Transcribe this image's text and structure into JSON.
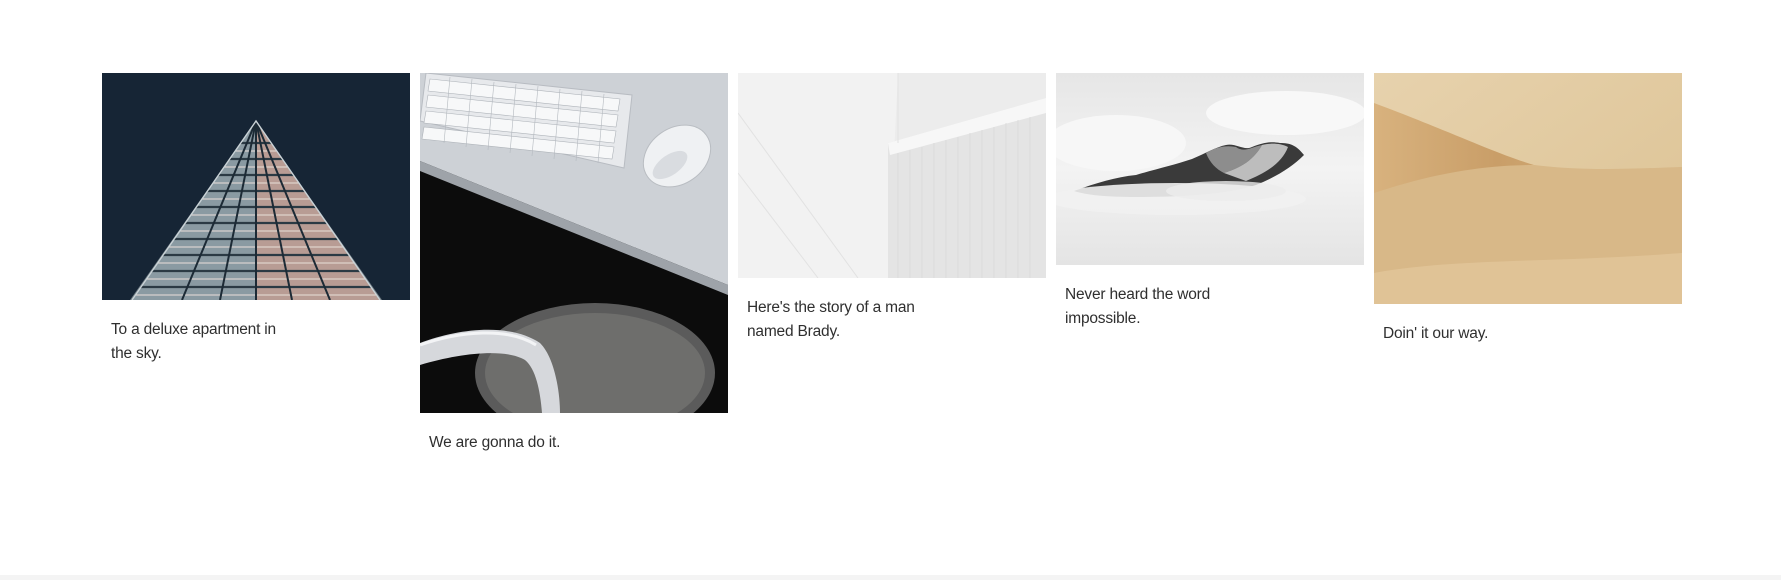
{
  "gallery": {
    "items": [
      {
        "caption": "To a deluxe apartment in the sky.",
        "image": "triangular-building-photo"
      },
      {
        "caption": "We are gonna do it.",
        "image": "desk-keyboard-mouse-photo"
      },
      {
        "caption": "Here's the story of a man named Brady.",
        "image": "white-architecture-photo"
      },
      {
        "caption": "Never heard the word impossible.",
        "image": "misty-mountain-photo"
      },
      {
        "caption": "Doin' it our way.",
        "image": "sand-dunes-photo"
      }
    ]
  },
  "colors": {
    "background": "#ffffff",
    "caption_text": "#2f2f2f",
    "footer_strip": "#f4f4f4"
  }
}
